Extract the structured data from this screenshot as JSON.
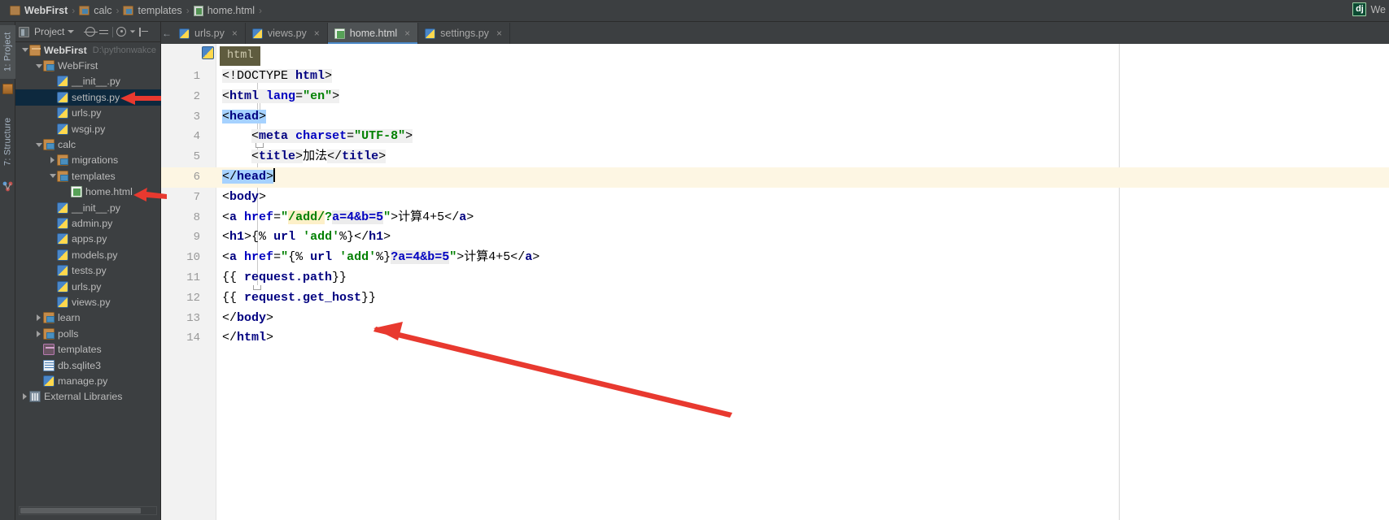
{
  "navbar": {
    "crumbs": [
      {
        "label": "WebFirst",
        "icon": "folder-icon",
        "bold": true
      },
      {
        "label": "calc",
        "icon": "module-folder-icon",
        "bold": false
      },
      {
        "label": "templates",
        "icon": "module-folder-icon",
        "bold": false
      },
      {
        "label": "home.html",
        "icon": "html-file-icon",
        "bold": false
      }
    ],
    "right": {
      "badge": "dj",
      "text": "We"
    }
  },
  "toolstrip": {
    "project_label": "1: Project",
    "structure_label": "7: Structure"
  },
  "project_panel": {
    "toolbar": {
      "title": "Project",
      "icons": [
        "project-view-icon",
        "chevron-down-icon",
        "locate-icon",
        "expand-collapse-icon",
        "settings-gear-icon",
        "hide-panel-icon"
      ]
    },
    "tree": [
      {
        "label": "WebFirst",
        "note": "D:\\pythonwakce",
        "icon": "folder-icon",
        "indent": 0,
        "arrow": "down",
        "bold": true,
        "selected": false
      },
      {
        "label": "WebFirst",
        "note": "",
        "icon": "module-folder-icon",
        "indent": 1,
        "arrow": "down",
        "bold": false,
        "selected": false
      },
      {
        "label": "__init__.py",
        "note": "",
        "icon": "python-file-icon",
        "indent": 2,
        "arrow": "none",
        "bold": false,
        "selected": false
      },
      {
        "label": "settings.py",
        "note": "",
        "icon": "python-file-icon",
        "indent": 2,
        "arrow": "none",
        "bold": false,
        "selected": true
      },
      {
        "label": "urls.py",
        "note": "",
        "icon": "python-file-icon",
        "indent": 2,
        "arrow": "none",
        "bold": false,
        "selected": false
      },
      {
        "label": "wsgi.py",
        "note": "",
        "icon": "python-file-icon",
        "indent": 2,
        "arrow": "none",
        "bold": false,
        "selected": false
      },
      {
        "label": "calc",
        "note": "",
        "icon": "module-folder-icon",
        "indent": 1,
        "arrow": "down",
        "bold": false,
        "selected": false
      },
      {
        "label": "migrations",
        "note": "",
        "icon": "module-folder-icon",
        "indent": 2,
        "arrow": "right",
        "bold": false,
        "selected": false
      },
      {
        "label": "templates",
        "note": "",
        "icon": "module-folder-icon",
        "indent": 2,
        "arrow": "down",
        "bold": false,
        "selected": false
      },
      {
        "label": "home.html",
        "note": "",
        "icon": "html-file-icon",
        "indent": 3,
        "arrow": "none",
        "bold": false,
        "selected": false
      },
      {
        "label": "__init__.py",
        "note": "",
        "icon": "python-file-icon",
        "indent": 2,
        "arrow": "none",
        "bold": false,
        "selected": false
      },
      {
        "label": "admin.py",
        "note": "",
        "icon": "python-file-icon",
        "indent": 2,
        "arrow": "none",
        "bold": false,
        "selected": false
      },
      {
        "label": "apps.py",
        "note": "",
        "icon": "python-file-icon",
        "indent": 2,
        "arrow": "none",
        "bold": false,
        "selected": false
      },
      {
        "label": "models.py",
        "note": "",
        "icon": "python-file-icon",
        "indent": 2,
        "arrow": "none",
        "bold": false,
        "selected": false
      },
      {
        "label": "tests.py",
        "note": "",
        "icon": "python-file-icon",
        "indent": 2,
        "arrow": "none",
        "bold": false,
        "selected": false
      },
      {
        "label": "urls.py",
        "note": "",
        "icon": "python-file-icon",
        "indent": 2,
        "arrow": "none",
        "bold": false,
        "selected": false
      },
      {
        "label": "views.py",
        "note": "",
        "icon": "python-file-icon",
        "indent": 2,
        "arrow": "none",
        "bold": false,
        "selected": false
      },
      {
        "label": "learn",
        "note": "",
        "icon": "module-folder-icon",
        "indent": 1,
        "arrow": "right",
        "bold": false,
        "selected": false
      },
      {
        "label": "polls",
        "note": "",
        "icon": "module-folder-icon",
        "indent": 1,
        "arrow": "right",
        "bold": false,
        "selected": false
      },
      {
        "label": "templates",
        "note": "",
        "icon": "templates-folder-icon",
        "indent": 1,
        "arrow": "none",
        "bold": false,
        "selected": false
      },
      {
        "label": "db.sqlite3",
        "note": "",
        "icon": "database-file-icon",
        "indent": 1,
        "arrow": "none",
        "bold": false,
        "selected": false
      },
      {
        "label": "manage.py",
        "note": "",
        "icon": "python-file-icon",
        "indent": 1,
        "arrow": "none",
        "bold": false,
        "selected": false
      },
      {
        "label": "External Libraries",
        "note": "",
        "icon": "library-icon",
        "indent": 0,
        "arrow": "right",
        "bold": false,
        "selected": false
      }
    ]
  },
  "tabs": [
    {
      "label": "urls.py",
      "icon": "python-file-icon",
      "active": false,
      "closable": true
    },
    {
      "label": "views.py",
      "icon": "python-file-icon",
      "active": false,
      "closable": true
    },
    {
      "label": "home.html",
      "icon": "html-file-icon",
      "active": true,
      "closable": true
    },
    {
      "label": "settings.py",
      "icon": "python-file-icon",
      "active": false,
      "closable": true
    }
  ],
  "editor": {
    "breadcrumb_tag": "html",
    "current_line": 6,
    "line_numbers": [
      "1",
      "2",
      "3",
      "4",
      "5",
      "6",
      "7",
      "8",
      "9",
      "10",
      "11",
      "12",
      "13",
      "14"
    ],
    "lines": [
      {
        "n": "1",
        "text": "<!DOCTYPE html>"
      },
      {
        "n": "2",
        "text": "<html lang=\"en\">"
      },
      {
        "n": "3",
        "text": "<head>"
      },
      {
        "n": "4",
        "text": "    <meta charset=\"UTF-8\">"
      },
      {
        "n": "5",
        "text": "    <title>加法</title>"
      },
      {
        "n": "6",
        "text": "</head>"
      },
      {
        "n": "7",
        "text": "<body>"
      },
      {
        "n": "8",
        "text": "<a href=\"/add/?a=4&b=5\">计算4+5</a>"
      },
      {
        "n": "9",
        "text": "<h1>{% url 'add' %}</h1>"
      },
      {
        "n": "10",
        "text": "<a href=\"{% url 'add' %}?a=4&b=5\">计算4+5</a>"
      },
      {
        "n": "11",
        "text": "{{ request.path}}"
      },
      {
        "n": "12",
        "text": "{{ request.get_host}}"
      },
      {
        "n": "13",
        "text": "</body>"
      },
      {
        "n": "14",
        "text": "</html>"
      }
    ]
  },
  "colors": {
    "accent": "#4a88c7",
    "selection": "#0d293e",
    "annotation_arrow": "#e8392f",
    "current_line": "#fdf6e3",
    "tag": "#000080",
    "attr": "#0000c0",
    "string": "#008000"
  }
}
